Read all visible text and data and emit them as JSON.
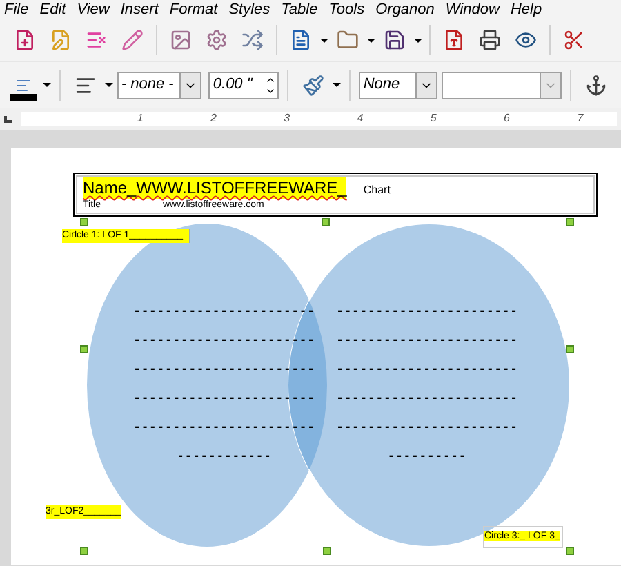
{
  "menu": [
    "File",
    "Edit",
    "View",
    "Insert",
    "Format",
    "Styles",
    "Table",
    "Tools",
    "Organon",
    "Window",
    "Help"
  ],
  "toolbar2": {
    "line_style": "- none -",
    "width": "0.00 \"",
    "area_style": "None"
  },
  "ruler": [
    "1",
    "2",
    "3",
    "4",
    "5",
    "6",
    "7"
  ],
  "header": {
    "name": "Name_WWW.LISTOFFREEWARE_",
    "chart": "Chart",
    "title": "Title",
    "url": "www.listoffreeware.com"
  },
  "labels": [
    {
      "text": "Cirlcle 1: LOF 1__________"
    },
    {
      "text": "3r_LOF2_______"
    },
    {
      "text": "Circle 3:_ LOF 3_"
    }
  ],
  "left_lines": [
    "-----------------------",
    "-----------------------",
    "-----------------------",
    "-----------------------",
    "-----------------------",
    "------------"
  ],
  "right_lines": [
    "-----------------------",
    "-----------------------",
    "-----------------------",
    "-----------------------",
    "-----------------------",
    "----------"
  ]
}
